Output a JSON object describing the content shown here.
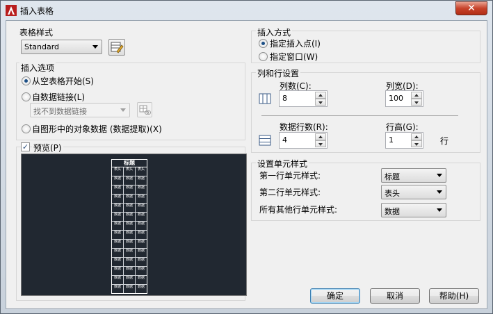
{
  "window": {
    "title": "插入表格",
    "close_label": "✕"
  },
  "table_style": {
    "label": "表格样式",
    "value": "Standard"
  },
  "insert_options": {
    "label": "插入选项",
    "from_empty": "从空表格开始(S)",
    "from_link": "自数据链接(L)",
    "link_value": "找不到数据链接",
    "from_objects": "自图形中的对象数据 (数据提取)(X)"
  },
  "preview": {
    "label": "预览(P)",
    "title_text": "标题",
    "header_text": "表头",
    "data_text": "数据",
    "header_rows": 1,
    "data_rows": 13
  },
  "insert_method": {
    "label": "插入方式",
    "point": "指定插入点(I)",
    "window": "指定窗口(W)"
  },
  "rows_cols": {
    "label": "列和行设置",
    "columns_label": "列数(C):",
    "columns_value": "8",
    "col_width_label": "列宽(D):",
    "col_width_value": "100",
    "data_rows_label": "数据行数(R):",
    "data_rows_value": "4",
    "row_height_label": "行高(G):",
    "row_height_value": "1",
    "row_unit": "行"
  },
  "cell_styles": {
    "label": "设置单元样式",
    "first_row_label": "第一行单元样式:",
    "first_row_value": "标题",
    "second_row_label": "第二行单元样式:",
    "second_row_value": "表头",
    "other_rows_label": "所有其他行单元样式:",
    "other_rows_value": "数据"
  },
  "buttons": {
    "ok": "确定",
    "cancel": "取消",
    "help": "帮助(H)"
  }
}
